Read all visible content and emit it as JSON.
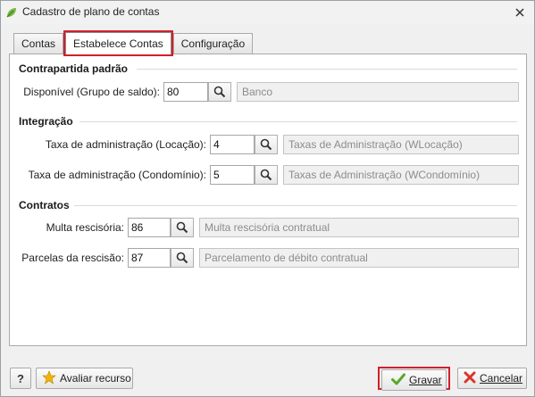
{
  "window": {
    "title": "Cadastro de plano de contas",
    "close_symbol": "✕"
  },
  "tabs": [
    {
      "label": "Contas",
      "active": false
    },
    {
      "label": "Estabelece Contas",
      "active": true,
      "highlighted": true
    },
    {
      "label": "Configuração",
      "active": false
    }
  ],
  "sections": {
    "contrapartida": {
      "title": "Contrapartida padrão",
      "rows": [
        {
          "label": "Disponível (Grupo de saldo):",
          "code": "80",
          "description": "Banco"
        }
      ]
    },
    "integracao": {
      "title": "Integração",
      "rows": [
        {
          "label": "Taxa de administração (Locação):",
          "code": "4",
          "description": "Taxas de Administração (WLocação)"
        },
        {
          "label": "Taxa de administração (Condomínio):",
          "code": "5",
          "description": "Taxas de Administração (WCondomínio)"
        }
      ]
    },
    "contratos": {
      "title": "Contratos",
      "rows": [
        {
          "label": "Multa rescisória:",
          "code": "86",
          "description": "Multa rescisória contratual"
        },
        {
          "label": "Parcelas da rescisão:",
          "code": "87",
          "description": "Parcelamento de débito contratual"
        }
      ]
    }
  },
  "footer": {
    "help_label": "?",
    "avaliar_label": "Avaliar recurso",
    "gravar_label": "Gravar",
    "cancelar_label": "Cancelar"
  },
  "colors": {
    "highlight": "#d0202b",
    "gravar_check": "#5aa82a",
    "cancel_x": "#d9342b",
    "star": "#f5b400"
  },
  "icons": {
    "app": "leaf-icon",
    "search": "search-icon",
    "help": "help-icon",
    "star": "star-icon",
    "check": "check-icon",
    "cancel": "cancel-x-icon"
  }
}
